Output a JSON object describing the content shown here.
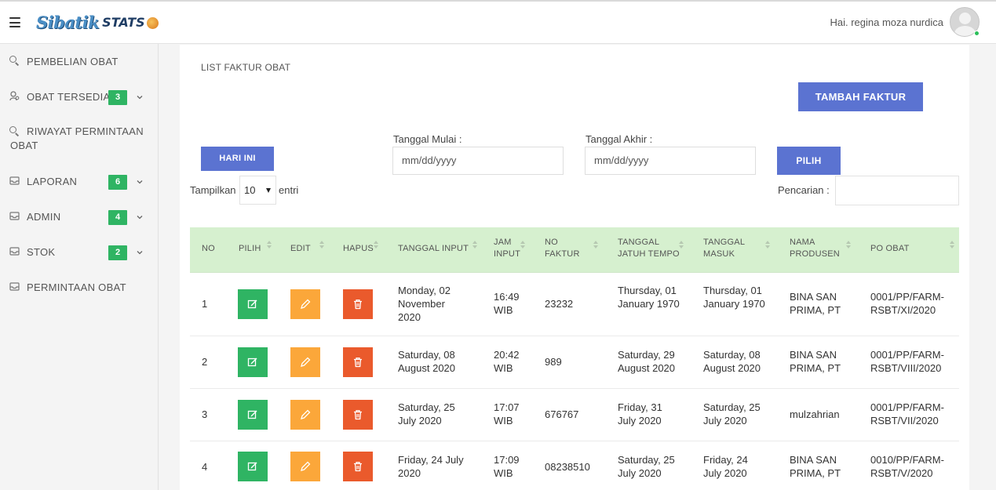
{
  "header": {
    "logo_main": "Sibatik",
    "logo_stats": "STATS",
    "greeting": "Hai. regina moza nurdica"
  },
  "sidebar": {
    "items": [
      {
        "label": "PEMBELIAN OBAT",
        "icon": "search-icon"
      },
      {
        "label": "OBAT TERSEDIA",
        "icon": "user-search-icon",
        "badge": "3"
      },
      {
        "label": "RIWAYAT PERMINTAAN OBAT",
        "icon": "search-icon"
      },
      {
        "label": "LAPORAN",
        "icon": "inbox-icon",
        "badge": "6"
      },
      {
        "label": "ADMIN",
        "icon": "inbox-icon",
        "badge": "4"
      },
      {
        "label": "STOK",
        "icon": "inbox-icon",
        "badge": "2"
      },
      {
        "label": "PERMINTAAN OBAT",
        "icon": "inbox-icon"
      }
    ]
  },
  "main": {
    "title": "LIST FAKTUR OBAT",
    "add_button": "TAMBAH FAKTUR",
    "today_button": "HARI INI",
    "start_label": "Tanggal Mulai :",
    "start_placeholder": "mm/dd/yyyy",
    "end_label": "Tanggal Akhir :",
    "end_placeholder": "mm/dd/yyyy",
    "pilih_button": "PILIH",
    "show_label": "Tampilkan",
    "entries_value": "10",
    "entries_suffix": "entri",
    "search_label": "Pencarian :"
  },
  "table": {
    "headers": [
      "NO",
      "PILIH",
      "EDIT",
      "HAPUS",
      "TANGGAL INPUT",
      "JAM INPUT",
      "NO FAKTUR",
      "TANGGAL JATUH TEMPO",
      "TANGGAL MASUK",
      "NAMA PRODUSEN",
      "PO OBAT"
    ],
    "rows": [
      {
        "no": "1",
        "tanggal_input": "Monday, 02 November 2020",
        "jam": "16:49 WIB",
        "faktur": "23232",
        "jatuh_tempo": "Thursday, 01 January 1970",
        "masuk": "Thursday, 01 January 1970",
        "produsen": "BINA SAN PRIMA, PT",
        "po": "0001/PP/FARM-RSBT/XI/2020"
      },
      {
        "no": "2",
        "tanggal_input": "Saturday, 08 August 2020",
        "jam": "20:42 WIB",
        "faktur": "989",
        "jatuh_tempo": "Saturday, 29 August 2020",
        "masuk": "Saturday, 08 August 2020",
        "produsen": "BINA SAN PRIMA, PT",
        "po": "0001/PP/FARM-RSBT/VIII/2020"
      },
      {
        "no": "3",
        "tanggal_input": "Saturday, 25 July 2020",
        "jam": "17:07 WIB",
        "faktur": "676767",
        "jatuh_tempo": "Friday, 31 July 2020",
        "masuk": "Saturday, 25 July 2020",
        "produsen": "mulzahrian",
        "po": "0001/PP/FARM-RSBT/VII/2020"
      },
      {
        "no": "4",
        "tanggal_input": "Friday, 24 July 2020",
        "jam": "17:09 WIB",
        "faktur": "08238510",
        "jatuh_tempo": "Saturday, 25 July 2020",
        "masuk": "Friday, 24 July 2020",
        "produsen": "BINA SAN PRIMA, PT",
        "po": "0010/PP/FARM-RSBT/V/2020"
      }
    ]
  },
  "colors": {
    "primary": "#5b73d1",
    "pilih": "#2fb463",
    "edit": "#fba73a",
    "hapus": "#ea5a2c",
    "table_header": "#d6f0cf",
    "badge": "#2fb463"
  }
}
